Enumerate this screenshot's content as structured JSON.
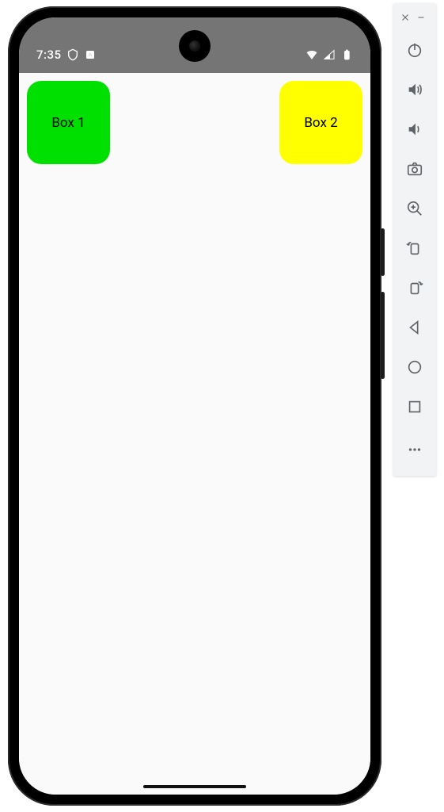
{
  "status_bar": {
    "time": "7:35",
    "icons_left": [
      "shield-icon",
      "notification-icon"
    ],
    "icons_right": [
      "wifi-icon",
      "signal-icon",
      "battery-icon"
    ]
  },
  "app": {
    "boxes": [
      {
        "label": "Box 1",
        "color": "#00E000"
      },
      {
        "label": "Box 2",
        "color": "#FFFF00"
      }
    ]
  },
  "emulator_toolbar": {
    "window_buttons": [
      "close",
      "minimize"
    ],
    "buttons": [
      "power",
      "volume-up",
      "volume-down",
      "screenshot",
      "zoom-in",
      "rotate-left",
      "rotate-right",
      "back",
      "home",
      "overview",
      "more"
    ]
  }
}
